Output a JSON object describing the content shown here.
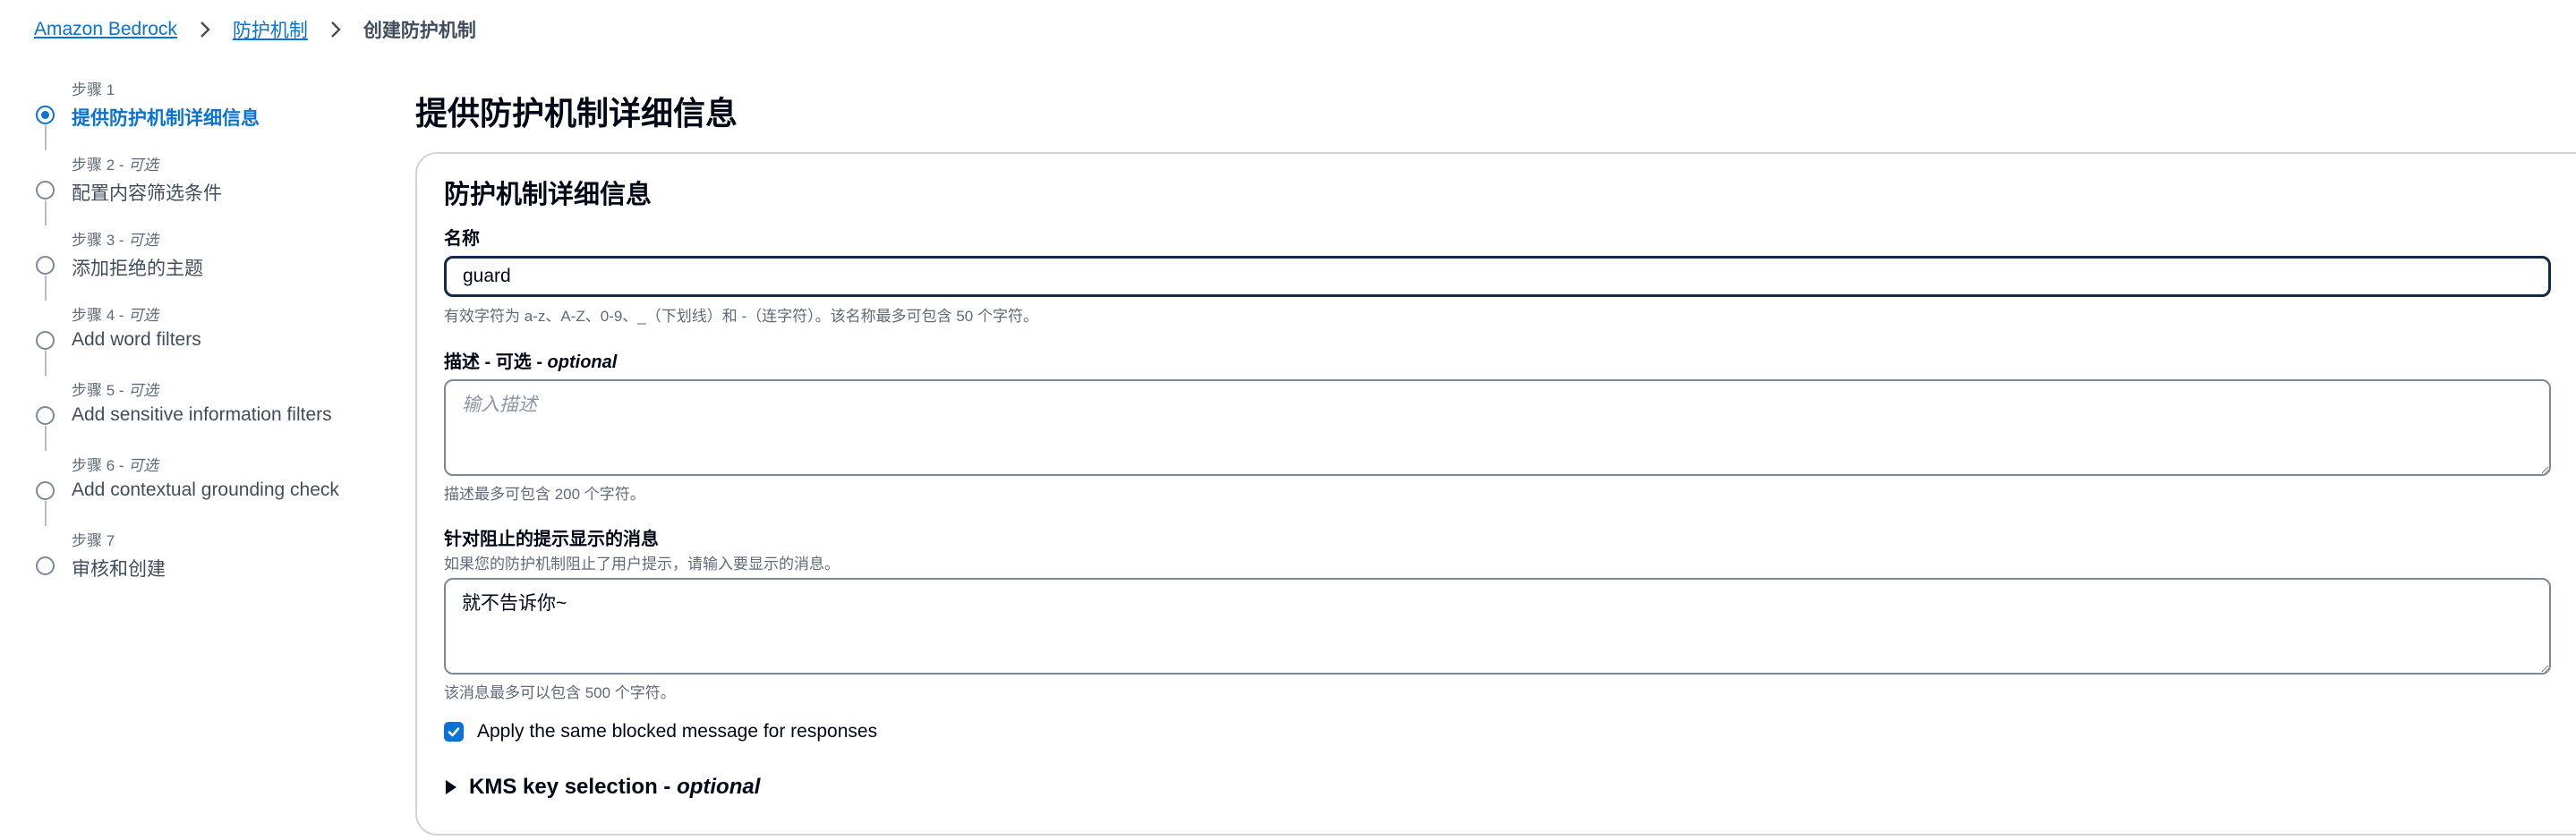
{
  "breadcrumb": {
    "items": [
      "Amazon Bedrock",
      "防护机制"
    ],
    "current": "创建防护机制"
  },
  "steps": [
    {
      "caption": "步骤 1",
      "optional": "",
      "label": "提供防护机制详细信息",
      "active": true
    },
    {
      "caption": "步骤 2 - ",
      "optional": "可选",
      "label": "配置内容筛选条件",
      "active": false
    },
    {
      "caption": "步骤 3 - ",
      "optional": "可选",
      "label": "添加拒绝的主题",
      "active": false
    },
    {
      "caption": "步骤 4 - ",
      "optional": "可选",
      "label": "Add word filters",
      "active": false
    },
    {
      "caption": "步骤 5 - ",
      "optional": "可选",
      "label": "Add sensitive information filters",
      "active": false
    },
    {
      "caption": "步骤 6 - ",
      "optional": "可选",
      "label": "Add contextual grounding check",
      "active": false
    },
    {
      "caption": "步骤 7",
      "optional": "",
      "label": "审核和创建",
      "active": false
    }
  ],
  "main": {
    "title": "提供防护机制详细信息",
    "panel_title": "防护机制详细信息",
    "name": {
      "label": "名称",
      "value": "guard",
      "hint": "有效字符为 a-z、A-Z、0-9、_（下划线）和 -（连字符）。该名称最多可包含 50 个字符。"
    },
    "description": {
      "label": "描述 - 可选 - ",
      "label_optional": "optional",
      "placeholder": "输入描述",
      "hint": "描述最多可包含 200 个字符。"
    },
    "blocked_message": {
      "label": "针对阻止的提示显示的消息",
      "sublabel": "如果您的防护机制阻止了用户提示，请输入要显示的消息。",
      "value": "就不告诉你~",
      "hint": "该消息最多可以包含 500 个字符。"
    },
    "same_message_checkbox": {
      "label": "Apply the same blocked message for responses",
      "checked": true
    },
    "kms": {
      "label": "KMS key selection - ",
      "optional": "optional"
    }
  },
  "colors": {
    "link": "#0972d3",
    "text": "#000716",
    "muted": "#5f6b7a",
    "input_border_focus": "#0f2a4a"
  }
}
